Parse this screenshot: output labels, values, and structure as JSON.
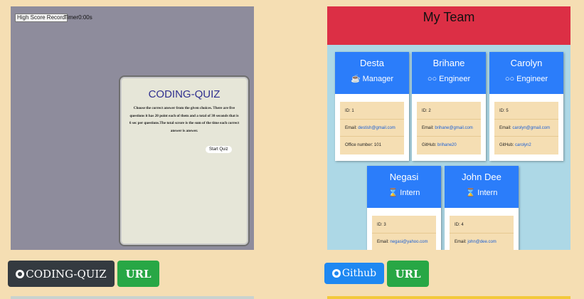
{
  "quiz_project": {
    "high_score_label": "High Score Record",
    "timer_label": "Timer0:00s",
    "title": "CODING-QUIZ",
    "description": "Choose the correct answer from the given choices. There are five questions it has 20 point each of them and a total of 30 seconds that is 6 sec per questions.The total scrore is the sum of the time each correct answer is answer.",
    "start_label": "Start Quiz",
    "repo_button": "CODING-QUIZ",
    "url_button": "URL"
  },
  "team_project": {
    "title": "My Team",
    "employees": [
      {
        "name": "Desta",
        "role": "Manager",
        "role_icon": "coffee-icon",
        "id": "ID: 1",
        "email_label": "Email: ",
        "email": "destish@gmail.com",
        "extra_label": "Office number: 101",
        "extra_link": ""
      },
      {
        "name": "Brihane",
        "role": "Engineer",
        "role_icon": "glasses-icon",
        "id": "ID: 2",
        "email_label": "Email: ",
        "email": "brihane@gmail.com",
        "extra_label": "GitHub: ",
        "extra_link": "brihane20"
      },
      {
        "name": "Carolyn",
        "role": "Engineer",
        "role_icon": "glasses-icon",
        "id": "ID: 5",
        "email_label": "Email: ",
        "email": "carolyn@gmail.com",
        "extra_label": "GitHub: ",
        "extra_link": "carolyn2"
      },
      {
        "name": "Negasi",
        "role": "Intern",
        "role_icon": "graduate-icon",
        "id": "ID: 3",
        "email_label": "Email: ",
        "email": "negasi@yahoo.com",
        "extra_label": "",
        "extra_link": ""
      },
      {
        "name": "John Dee",
        "role": "Intern",
        "role_icon": "graduate-icon",
        "id": "ID: 4",
        "email_label": "Email: ",
        "email": "john@dee.com",
        "extra_label": "",
        "extra_link": ""
      }
    ],
    "repo_button": "Github",
    "url_button": "URL"
  },
  "colors": {
    "page_bg": "#f5deb3",
    "header_red": "#dc2f45",
    "card_blue": "#2b7dfa",
    "button_green": "#28a745",
    "button_dark": "#343a40",
    "button_blue": "#1e88f2"
  }
}
